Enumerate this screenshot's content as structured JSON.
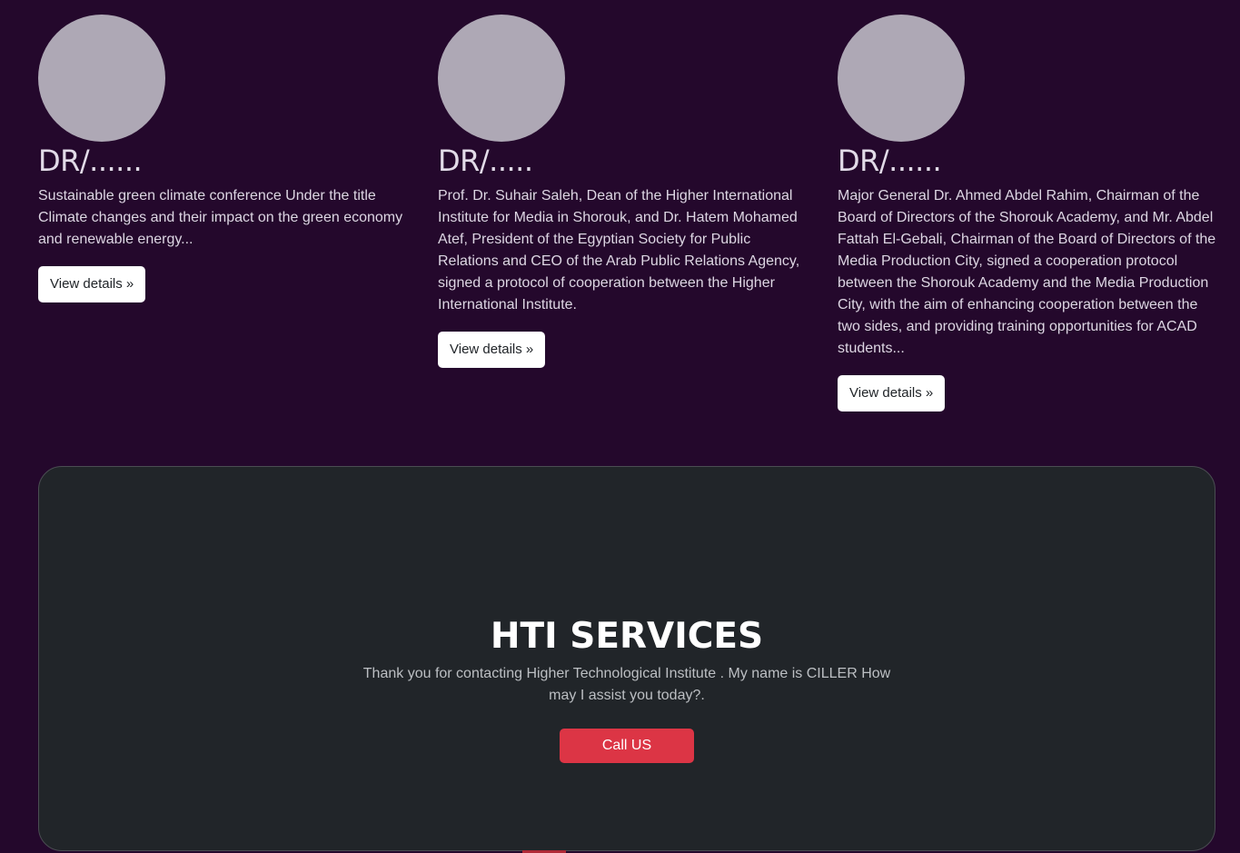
{
  "cards": [
    {
      "title": "DR/......",
      "text": "Sustainable green climate conference Under the title Climate changes and their impact on the green economy and renewable energy...",
      "button": "View details »"
    },
    {
      "title": "DR/.....",
      "text": "Prof. Dr. Suhair Saleh, Dean of the Higher International Institute for Media in Shorouk, and Dr. Hatem Mohamed Atef, President of the Egyptian Society for Public Relations and CEO of the Arab Public Relations Agency, signed a protocol of cooperation between the Higher International Institute.",
      "button": "View details »"
    },
    {
      "title": "DR/......",
      "text": "Major General Dr. Ahmed Abdel Rahim, Chairman of the Board of Directors of the Shorouk Academy, and Mr. Abdel Fattah El-Gebali, Chairman of the Board of Directors of the Media Production City, signed a cooperation protocol between the Shorouk Academy and the Media Production City, with the aim of enhancing cooperation between the two sides, and providing training opportunities for ACAD students...",
      "button": "View details »"
    }
  ],
  "services": {
    "title": "HTI SERVICES",
    "text": "Thank you for contacting Higher Technological Institute . My name is CILLER How may I assist you today?.",
    "button": "Call US"
  },
  "colors": {
    "page_background": "#24082c",
    "panel_background": "#212529",
    "avatar": "#aea8b5",
    "danger": "#dc3545"
  }
}
